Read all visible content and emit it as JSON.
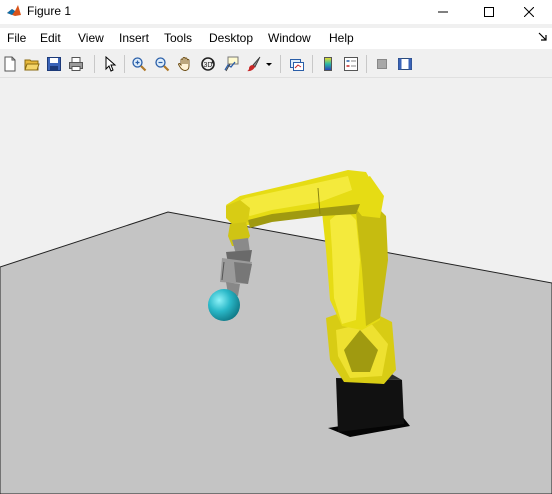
{
  "window": {
    "title": "Figure 1"
  },
  "menu": [
    "File",
    "Edit",
    "View",
    "Insert",
    "Tools",
    "Desktop",
    "Window",
    "Help"
  ],
  "toolbar": [
    "new-figure-icon",
    "open-file-icon",
    "save-icon",
    "print-icon",
    "pointer-icon",
    "zoom-in-icon",
    "zoom-out-icon",
    "pan-hand-icon",
    "rotate-3d-icon",
    "data-cursor-icon",
    "brush-icon",
    "brush-dropdown-icon",
    "link-plot-icon",
    "colorbar-icon",
    "legend-icon",
    "hide-plot-tools-icon",
    "show-plot-tools-icon"
  ],
  "colors": {
    "robot_yellow": "#e6dc14",
    "robot_dark": "#a09a10",
    "floor": "#c4c4c4",
    "pedestal": "#111111",
    "sphere": "#2ab8c8",
    "background": "#f0f0f0"
  }
}
